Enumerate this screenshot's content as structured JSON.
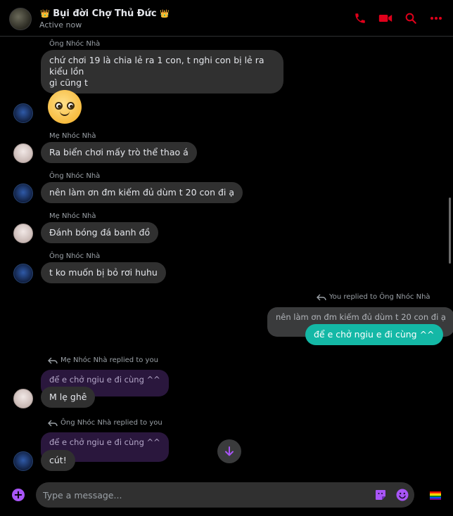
{
  "header": {
    "title": "Bụi đời Chợ Thủ Đức",
    "status": "Active now",
    "crown_glyph": "👑",
    "icons": [
      "phone-icon",
      "video-call-icon",
      "search-icon",
      "more-icon"
    ],
    "accent_color": "#e0001b"
  },
  "messages": {
    "m1": {
      "sender": "Ông Nhóc Nhà",
      "lines": [
        "chứ chơi 19 là chia lẻ ra 1 con, t nghi con bị lẻ ra kiểu lồn",
        "gì cũng t"
      ]
    },
    "m2": {
      "sender": "Ông Nhóc Nhà",
      "emoji": "smiling-face-emoji"
    },
    "m3": {
      "sender": "Mẹ Nhóc Nhà",
      "text": "Ra biển chơi mấy trò thể thao á"
    },
    "m4": {
      "sender": "Ông Nhóc Nhà",
      "text": "nên làm ơn đm kiếm đủ dùm t 20 con đi ạ"
    },
    "m5": {
      "sender": "Mẹ Nhóc Nhà",
      "text": "Đánh bóng đá banh đồ"
    },
    "m6": {
      "sender": "Ông Nhóc Nhà",
      "text": "t ko muốn bị bỏ rơi huhu"
    },
    "m7": {
      "reply_label": "You replied to Ông Nhóc Nhà",
      "quoted": "nên làm ơn đm kiếm đủ dùm t 20 con đi ạ",
      "text": "để e chở ngiu e đi cùng ^^"
    },
    "m8": {
      "reply_label": "Mẹ Nhóc Nhà replied to you",
      "quoted": "để e chở ngiu e đi cùng ^^",
      "text": "M lẹ ghê"
    },
    "m9": {
      "reply_label": "Ông Nhóc Nhà replied to you",
      "quoted": "để e chở ngiu e đi cùng ^^",
      "text": "cút!"
    }
  },
  "composer": {
    "placeholder": "Type a message...",
    "icons": [
      "add-icon",
      "sticker-icon",
      "emoji-icon",
      "theme-icon"
    ],
    "accent_color": "#a855f7"
  },
  "colors": {
    "self_bubble": "#14b8a6",
    "other_bubble": "#303030",
    "quoted_reply": "#2a173d"
  }
}
